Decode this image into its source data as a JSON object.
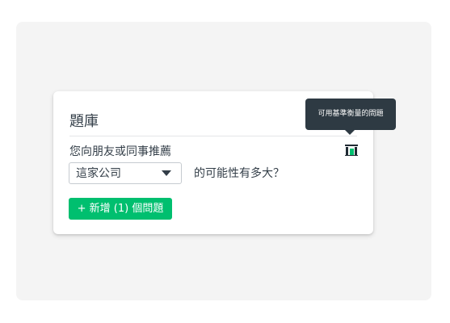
{
  "card": {
    "title": "題庫",
    "question_prefix": "您向朋友或同事推薦",
    "select_value": "這家公司",
    "question_suffix": "的可能性有多大？",
    "add_button_label": "+ 新增 (1) 個問題",
    "benchmark_icon": "benchmark-icon"
  },
  "tooltip": {
    "text": "可用基準衡量的問題"
  },
  "colors": {
    "accent": "#00bf6f",
    "tooltip_bg": "#2e3a43",
    "text": "#333e48",
    "icon_dark": "#1f2a33",
    "icon_green": "#00bf6f"
  }
}
